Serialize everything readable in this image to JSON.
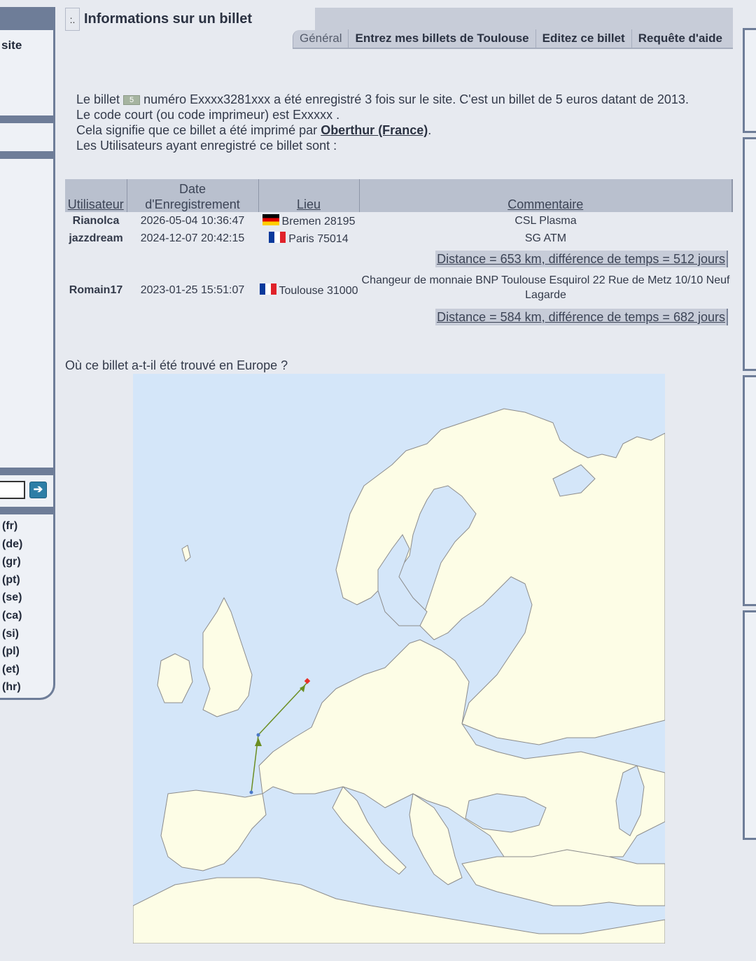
{
  "sidebar": {
    "site_label": "site",
    "search": {
      "value": "",
      "go_symbol": "➔"
    },
    "languages": [
      "(fr)",
      "(de)",
      "(gr)",
      "(pt)",
      "(se)",
      "(ca)",
      "(si)",
      "(pl)",
      "(et)",
      "(hr)"
    ]
  },
  "header": {
    "badge": ":.",
    "title": "Informations sur un billet"
  },
  "tabs": [
    {
      "label": "Général",
      "active": true
    },
    {
      "label": "Entrez mes billets de Toulouse",
      "active": false
    },
    {
      "label": "Editez ce billet",
      "active": false
    },
    {
      "label": "Requête d'aide",
      "active": false
    }
  ],
  "info": {
    "line1_prefix": "Le billet",
    "note_icon_label": "5",
    "line1_suffix": "numéro Exxxx3281xxx a été enregistré 3 fois sur le site. C'est un billet de 5 euros datant de 2013.",
    "line2": "Le code court (ou code imprimeur) est Exxxxx .",
    "line3_prefix": "Cela signifie que ce billet a été imprimé par",
    "printer": "Oberthur (France)",
    "line3_suffix": ".",
    "line4": "Les Utilisateurs ayant enregistré ce billet sont :"
  },
  "table": {
    "headers": [
      "Utilisateur",
      "Date d'Enregistrement",
      "Lieu",
      "Commentaire"
    ],
    "rows": [
      {
        "user": "Rianolca",
        "date": "2026-05-04 10:36:47",
        "flag": "de",
        "place": "Bremen 28195",
        "comment": "CSL Plasma"
      },
      {
        "user": "jazzdream",
        "date": "2024-12-07 20:42:15",
        "flag": "fr",
        "place": "Paris 75014",
        "comment": "SG ATM"
      },
      {
        "user": "Romain17",
        "date": "2023-01-25 15:51:07",
        "flag": "fr",
        "place": "Toulouse 31000",
        "comment": "Changeur de monnaie BNP Toulouse Esquirol 22 Rue de Metz 10/10 Neuf Lagarde"
      }
    ],
    "distances": [
      "Distance = 653 km, différence de temps = 512 jours",
      "Distance = 584 km, différence de temps = 682 jours"
    ]
  },
  "map": {
    "heading": "Où ce billet a-t-il été trouvé en Europe ?",
    "colors": {
      "sea": "#d4e6f9",
      "land": "#fdfde6",
      "border": "#8c8c8c",
      "route": "#6b8e23",
      "marker_start": "#4a78c8",
      "marker_end": "#e8302a"
    }
  }
}
